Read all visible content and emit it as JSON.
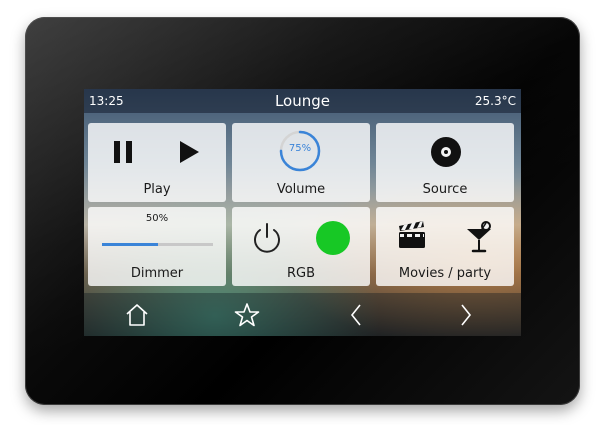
{
  "status": {
    "time": "13:25",
    "room": "Lounge",
    "temperature": "25.3°C"
  },
  "tiles": {
    "play": {
      "label": "Play",
      "icons": [
        "pause-icon",
        "play-icon"
      ]
    },
    "volume": {
      "label": "Volume",
      "value_text": "75%",
      "level": 0.75,
      "accent": "#3a84d8"
    },
    "source": {
      "label": "Source",
      "icon": "disc-icon"
    },
    "dimmer": {
      "label": "Dimmer",
      "value_text": "50%",
      "level": 0.5
    },
    "rgb": {
      "label": "RGB",
      "icon": "power-icon",
      "color": "#17c825"
    },
    "scene": {
      "label": "Movies / party",
      "icons": [
        "clapper-icon",
        "cocktail-icon"
      ]
    }
  },
  "navbar": {
    "items": [
      "home-icon",
      "star-icon",
      "chevron-left-icon",
      "chevron-right-icon"
    ]
  }
}
